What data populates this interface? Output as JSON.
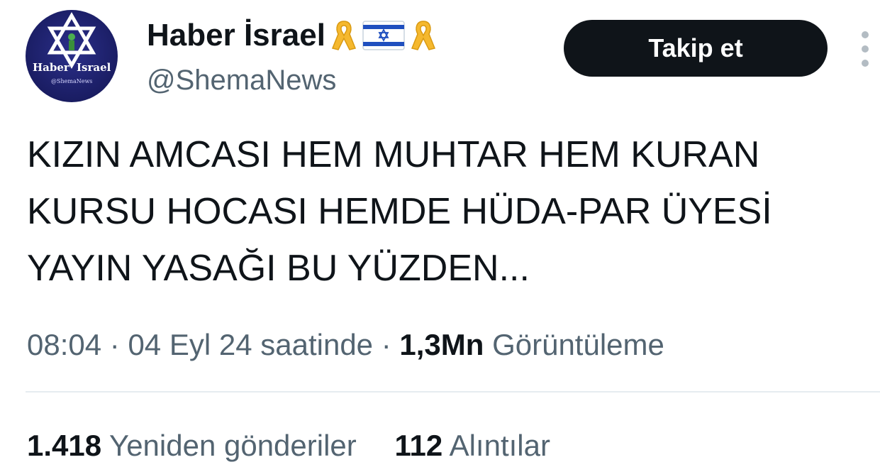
{
  "author": {
    "display_name": "Haber İsrael",
    "name_emojis": [
      "yellow-ribbon-icon",
      "israel-flag-icon",
      "yellow-ribbon-icon"
    ],
    "handle": "@ShemaNews",
    "avatar_text": {
      "line1": "Haber",
      "line2": "Israel",
      "line3": "@ShemaNews"
    }
  },
  "follow_button": {
    "label": "Takip et"
  },
  "more_options": {
    "icon": "more-vertical-icon"
  },
  "tweet": {
    "lines": [
      "KIZIN AMCASI HEM MUHTAR HEM KURAN",
      "KURSU HOCASI HEMDE HÜDA-PAR ÜYESİ",
      "YAYIN YASAĞI BU YÜZDEN..."
    ]
  },
  "meta": {
    "time": "08:04",
    "separator": "·",
    "date_text": "04 Eyl 24 saatinde",
    "views_count": "1,3Mn",
    "views_label": "Görüntüleme"
  },
  "stats": {
    "reposts_count": "1.418",
    "reposts_label": "Yeniden gönderiler",
    "quotes_count": "112",
    "quotes_label": "Alıntılar"
  },
  "colors": {
    "text_primary": "#0f1419",
    "text_secondary": "#536471",
    "follow_bg": "#0f1419",
    "divider": "#e6ecf0",
    "avatar_bg": "#1a1d63",
    "ribbon_yellow": "#f5b82e",
    "flag_blue": "#1f4fbf"
  }
}
